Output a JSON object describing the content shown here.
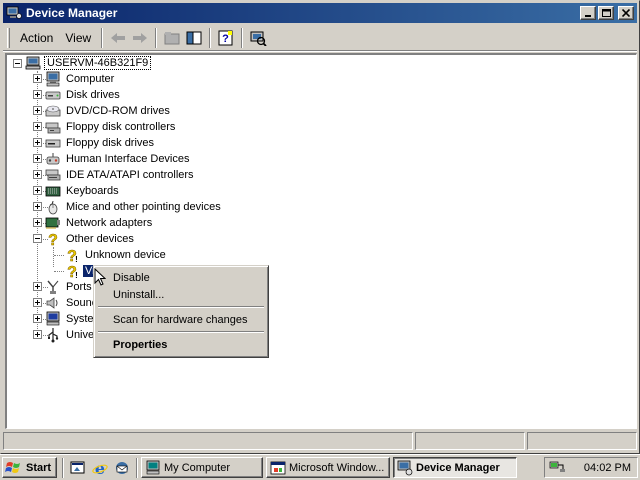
{
  "window": {
    "title": "Device Manager",
    "controls": {
      "minimize": "_",
      "maximize": "□",
      "close": "✕"
    }
  },
  "menu": {
    "action_label": "Action",
    "view_label": "View"
  },
  "tree": {
    "root": "USERVM-46B321F9",
    "categories": [
      {
        "label": "Computer",
        "icon": "computer-icon",
        "expanded": false
      },
      {
        "label": "Disk drives",
        "icon": "disk-drive-icon",
        "expanded": false
      },
      {
        "label": "DVD/CD-ROM drives",
        "icon": "cdrom-icon",
        "expanded": false
      },
      {
        "label": "Floppy disk controllers",
        "icon": "controller-icon",
        "expanded": false
      },
      {
        "label": "Floppy disk drives",
        "icon": "floppy-icon",
        "expanded": false
      },
      {
        "label": "Human Interface Devices",
        "icon": "hid-icon",
        "expanded": false
      },
      {
        "label": "IDE ATA/ATAPI controllers",
        "icon": "ide-icon",
        "expanded": false
      },
      {
        "label": "Keyboards",
        "icon": "keyboard-icon",
        "expanded": false
      },
      {
        "label": "Mice and other pointing devices",
        "icon": "mouse-icon",
        "expanded": false
      },
      {
        "label": "Network adapters",
        "icon": "network-icon",
        "expanded": false
      },
      {
        "label": "Other devices",
        "icon": "question-icon",
        "expanded": true
      },
      {
        "label": "Ports",
        "icon": "port-icon",
        "expanded": false
      },
      {
        "label": "Sounc",
        "icon": "sound-icon",
        "expanded": false
      },
      {
        "label": "Syster",
        "icon": "system-icon",
        "expanded": false
      },
      {
        "label": "Univer",
        "icon": "usb-icon",
        "expanded": false
      }
    ],
    "other_devices_children": [
      {
        "label": "Unknown device",
        "selected": false
      },
      {
        "label": "Vi",
        "selected": true
      }
    ]
  },
  "context_menu": {
    "items": [
      "Disable",
      "Uninstall...",
      "Scan for hardware changes",
      "Properties"
    ]
  },
  "taskbar": {
    "start_label": "Start",
    "tasks": [
      {
        "label": "My Computer",
        "active": false
      },
      {
        "label": "Microsoft Window...",
        "active": false
      },
      {
        "label": "Device Manager",
        "active": true
      }
    ],
    "clock": "04:02 PM"
  },
  "colors": {
    "title_active": "#0a246a",
    "title_gradient_end": "#3a6ea5",
    "face": "#d4d0c8",
    "selection": "#0a246a",
    "desktop": "#008080"
  }
}
